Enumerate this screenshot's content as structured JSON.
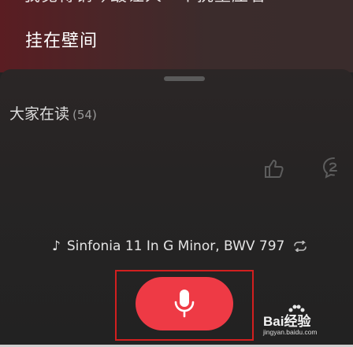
{
  "header": {
    "clipped_text": "我觉得钢琴最让人一个挑重压着",
    "title": "挂在壁间"
  },
  "section": {
    "title": "大家在读",
    "count": "(54)"
  },
  "actions": {
    "like_icon": "thumbs-up-icon",
    "comment_icon": "comment-icon"
  },
  "player": {
    "note_glyph": "♪",
    "track_title": "Sinfonia 11 In G Minor, BWV 797",
    "loop_icon": "loop-icon"
  },
  "mic": {
    "icon": "microphone-icon",
    "color": "#ee3a45"
  },
  "watermark": {
    "brand": "Bai经验",
    "url": "jingyan.baidu.com"
  },
  "colors": {
    "highlight": "#d21f1f",
    "background": "#232323"
  }
}
